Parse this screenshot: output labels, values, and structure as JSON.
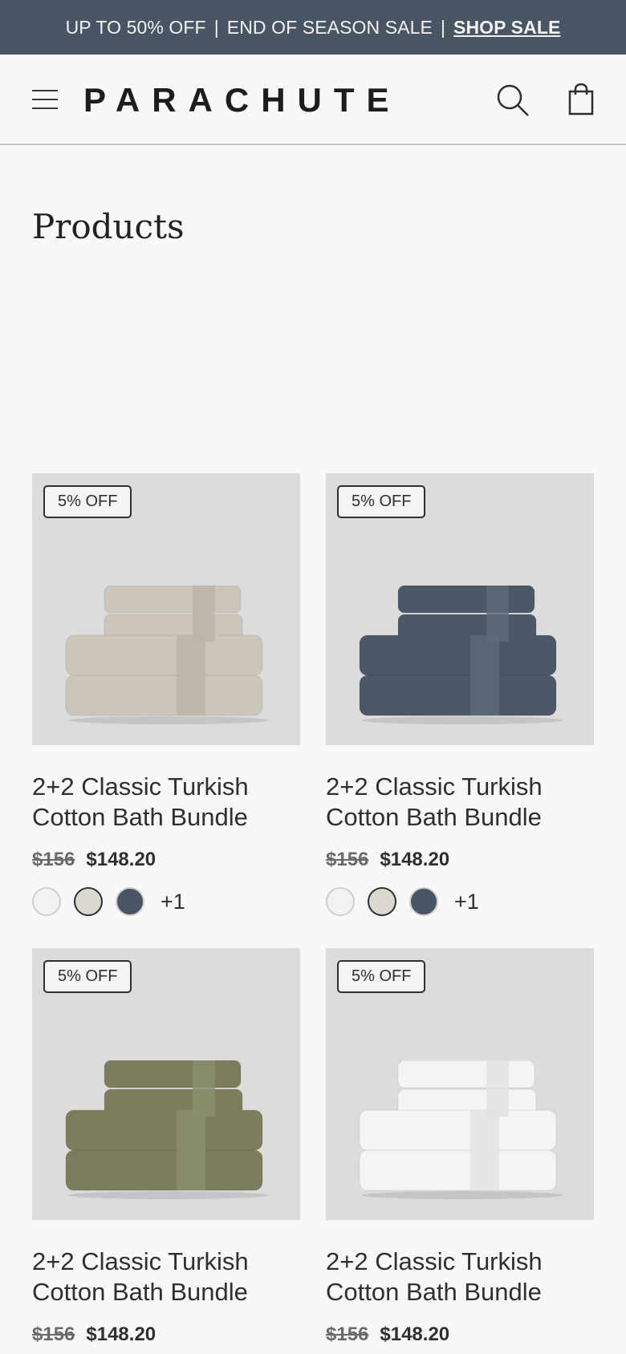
{
  "promo": {
    "part1": "UP TO 50% OFF",
    "sep1": "|",
    "part2": "END OF SEASON SALE",
    "sep2": "|",
    "link": "SHOP SALE"
  },
  "header": {
    "logo": "PARACHUTE",
    "icons": [
      "menu-icon",
      "search-icon",
      "bag-icon"
    ]
  },
  "page": {
    "title": "Products"
  },
  "products": [
    {
      "badge": "5% OFF",
      "name": "2+2 Classic Turkish Cotton Bath Bundle",
      "old_price": "$156",
      "price": "$148.20",
      "towel_color": "#cbc5ba",
      "stripe_color": "#bbb4a8",
      "swatches": [
        "#f2f2f2",
        "#d9d7d0",
        "#4a5563"
      ],
      "more": "+1"
    },
    {
      "badge": "5% OFF",
      "name": "2+2 Classic Turkish Cotton Bath Bundle",
      "old_price": "$156",
      "price": "$148.20",
      "towel_color": "#4c5866",
      "stripe_color": "#5e6b79",
      "swatches": [
        "#f2f2f2",
        "#d9d7d0",
        "#4a5563"
      ],
      "more": "+1"
    },
    {
      "badge": "5% OFF",
      "name": "2+2 Classic Turkish Cotton Bath Bundle",
      "old_price": "$156",
      "price": "$148.20",
      "towel_color": "#7b7d5d",
      "stripe_color": "#8c8e6d",
      "swatches": [],
      "more": ""
    },
    {
      "badge": "5% OFF",
      "name": "2+2 Classic Turkish Cotton Bath Bundle",
      "old_price": "$156",
      "price": "$148.20",
      "towel_color": "#f4f4f4",
      "stripe_color": "#e2e2e2",
      "swatches": [],
      "more": ""
    }
  ]
}
